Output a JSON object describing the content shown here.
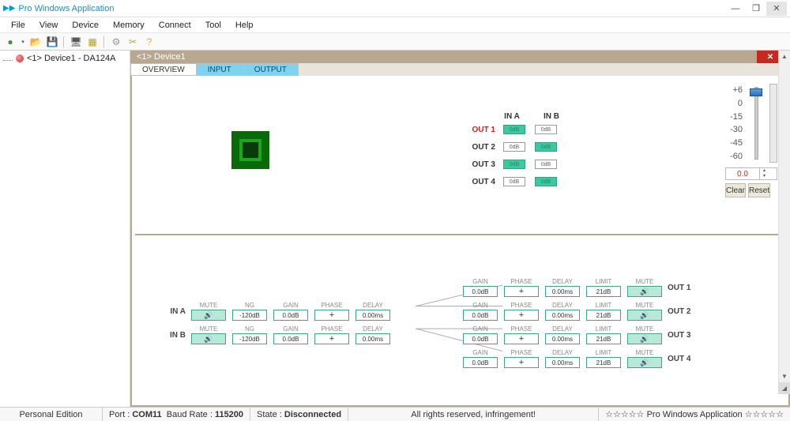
{
  "app": {
    "title": "Pro Windows Application"
  },
  "menu": [
    "File",
    "View",
    "Device",
    "Memory",
    "Connect",
    "Tool",
    "Help"
  ],
  "tree": {
    "node": "<1> Device1 - DA124A"
  },
  "device": {
    "header": "<1> Device1"
  },
  "tabs": [
    "OVERVIEW",
    "INPUT",
    "OUTPUT"
  ],
  "matrix": {
    "cols": [
      "IN A",
      "IN B"
    ],
    "rows": [
      "OUT 1",
      "OUT 2",
      "OUT 3",
      "OUT 4"
    ],
    "cell_label": "0dB",
    "active": [
      [
        true,
        false
      ],
      [
        false,
        true
      ],
      [
        true,
        false
      ],
      [
        false,
        true
      ]
    ]
  },
  "fader": {
    "ticks": [
      "+6",
      "0",
      "-15",
      "-30",
      "-45",
      "-60"
    ],
    "value": "0.0",
    "clear": "Clear",
    "reset": "Reset"
  },
  "chain": {
    "inputs": [
      {
        "label": "IN A",
        "ng": "-120dB",
        "gain": "0.0dB",
        "phase": "+",
        "delay": "0.00ms"
      },
      {
        "label": "IN B",
        "ng": "-120dB",
        "gain": "0.0dB",
        "phase": "+",
        "delay": "0.00ms"
      }
    ],
    "outputs": [
      {
        "gain": "0.0dB",
        "phase": "+",
        "delay": "0.00ms",
        "limit": "21dB",
        "label": "OUT 1"
      },
      {
        "gain": "0.0dB",
        "phase": "+",
        "delay": "0.00ms",
        "limit": "21dB",
        "label": "OUT 2"
      },
      {
        "gain": "0.0dB",
        "phase": "+",
        "delay": "0.00ms",
        "limit": "21dB",
        "label": "OUT 3"
      },
      {
        "gain": "0.0dB",
        "phase": "+",
        "delay": "0.00ms",
        "limit": "21dB",
        "label": "OUT 4"
      }
    ],
    "headers": {
      "mute": "MUTE",
      "ng": "NG",
      "gain": "GAIN",
      "phase": "PHASE",
      "delay": "DELAY",
      "limit": "LIMIT"
    }
  },
  "status": {
    "edition": "Personal Edition",
    "port_label": "Port :",
    "port": "COM11",
    "baud_label": "Baud Rate :",
    "baud": "115200",
    "state_label": "State :",
    "state": "Disconnected",
    "center": "All rights reserved, infringement!",
    "right": "☆☆☆☆☆ Pro Windows Application ☆☆☆☆☆"
  }
}
